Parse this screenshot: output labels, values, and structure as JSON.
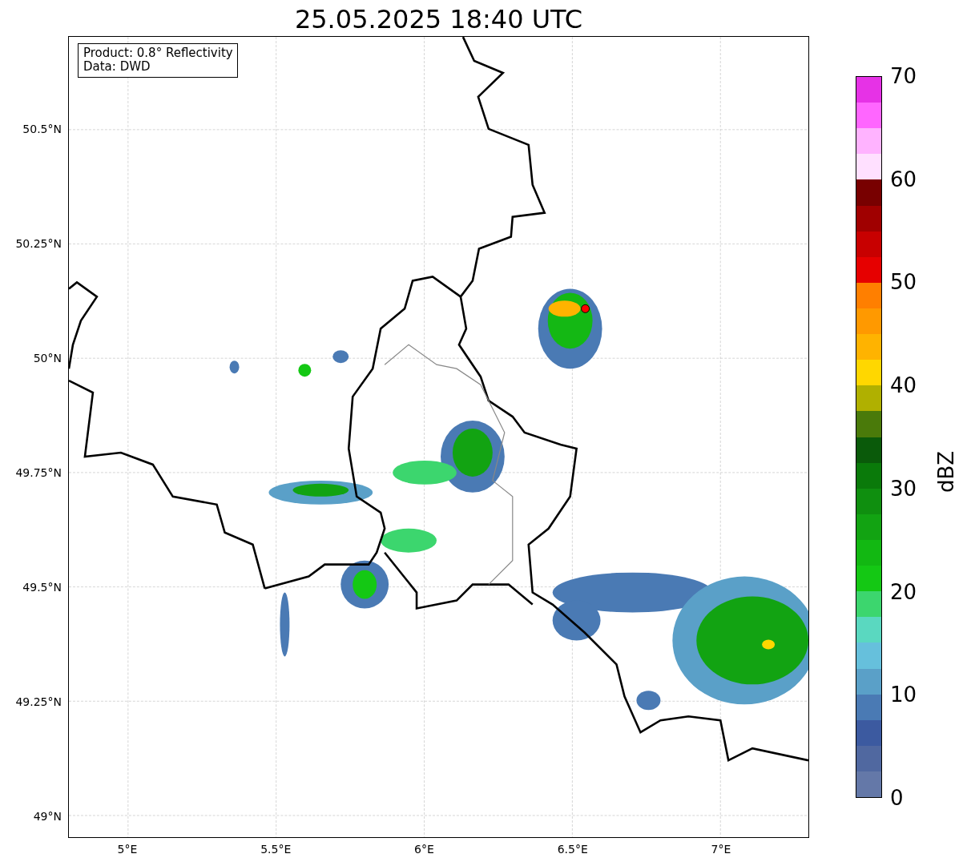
{
  "title": "25.05.2025 18:40 UTC",
  "map": {
    "legend": [
      "Product: 0.8° Reflectivity",
      "Data: DWD"
    ],
    "xticks": [
      "5°E",
      "5.5°E",
      "6°E",
      "6.5°E",
      "7°E"
    ],
    "yticks": [
      "50.5°N",
      "50.25°N",
      "50°N",
      "49.75°N",
      "49.5°N",
      "49.25°N",
      "49°N"
    ]
  },
  "colorbar": {
    "label": "dBZ",
    "ticks": [
      "70",
      "60",
      "50",
      "40",
      "30",
      "20",
      "10",
      "0"
    ],
    "segments": [
      {
        "color": "#e632e6"
      },
      {
        "color": "#ff66ff"
      },
      {
        "color": "#ffb3ff"
      },
      {
        "color": "#ffe0ff"
      },
      {
        "color": "#780000"
      },
      {
        "color": "#a00000"
      },
      {
        "color": "#c80000"
      },
      {
        "color": "#e60000"
      },
      {
        "color": "#ff7f00"
      },
      {
        "color": "#ff9900"
      },
      {
        "color": "#ffb300"
      },
      {
        "color": "#ffd700"
      },
      {
        "color": "#b0b000"
      },
      {
        "color": "#4a7a0a"
      },
      {
        "color": "#0a5a0a"
      },
      {
        "color": "#0a7a0a"
      },
      {
        "color": "#0f8f0f"
      },
      {
        "color": "#12a312"
      },
      {
        "color": "#12b812"
      },
      {
        "color": "#14c814"
      },
      {
        "color": "#3cd66e"
      },
      {
        "color": "#5ad8c0"
      },
      {
        "color": "#66c0dc"
      },
      {
        "color": "#5aa0c8"
      },
      {
        "color": "#4a7ab4"
      },
      {
        "color": "#3c5aa0"
      },
      {
        "color": "#5068a0"
      },
      {
        "color": "#6478a8"
      }
    ]
  }
}
